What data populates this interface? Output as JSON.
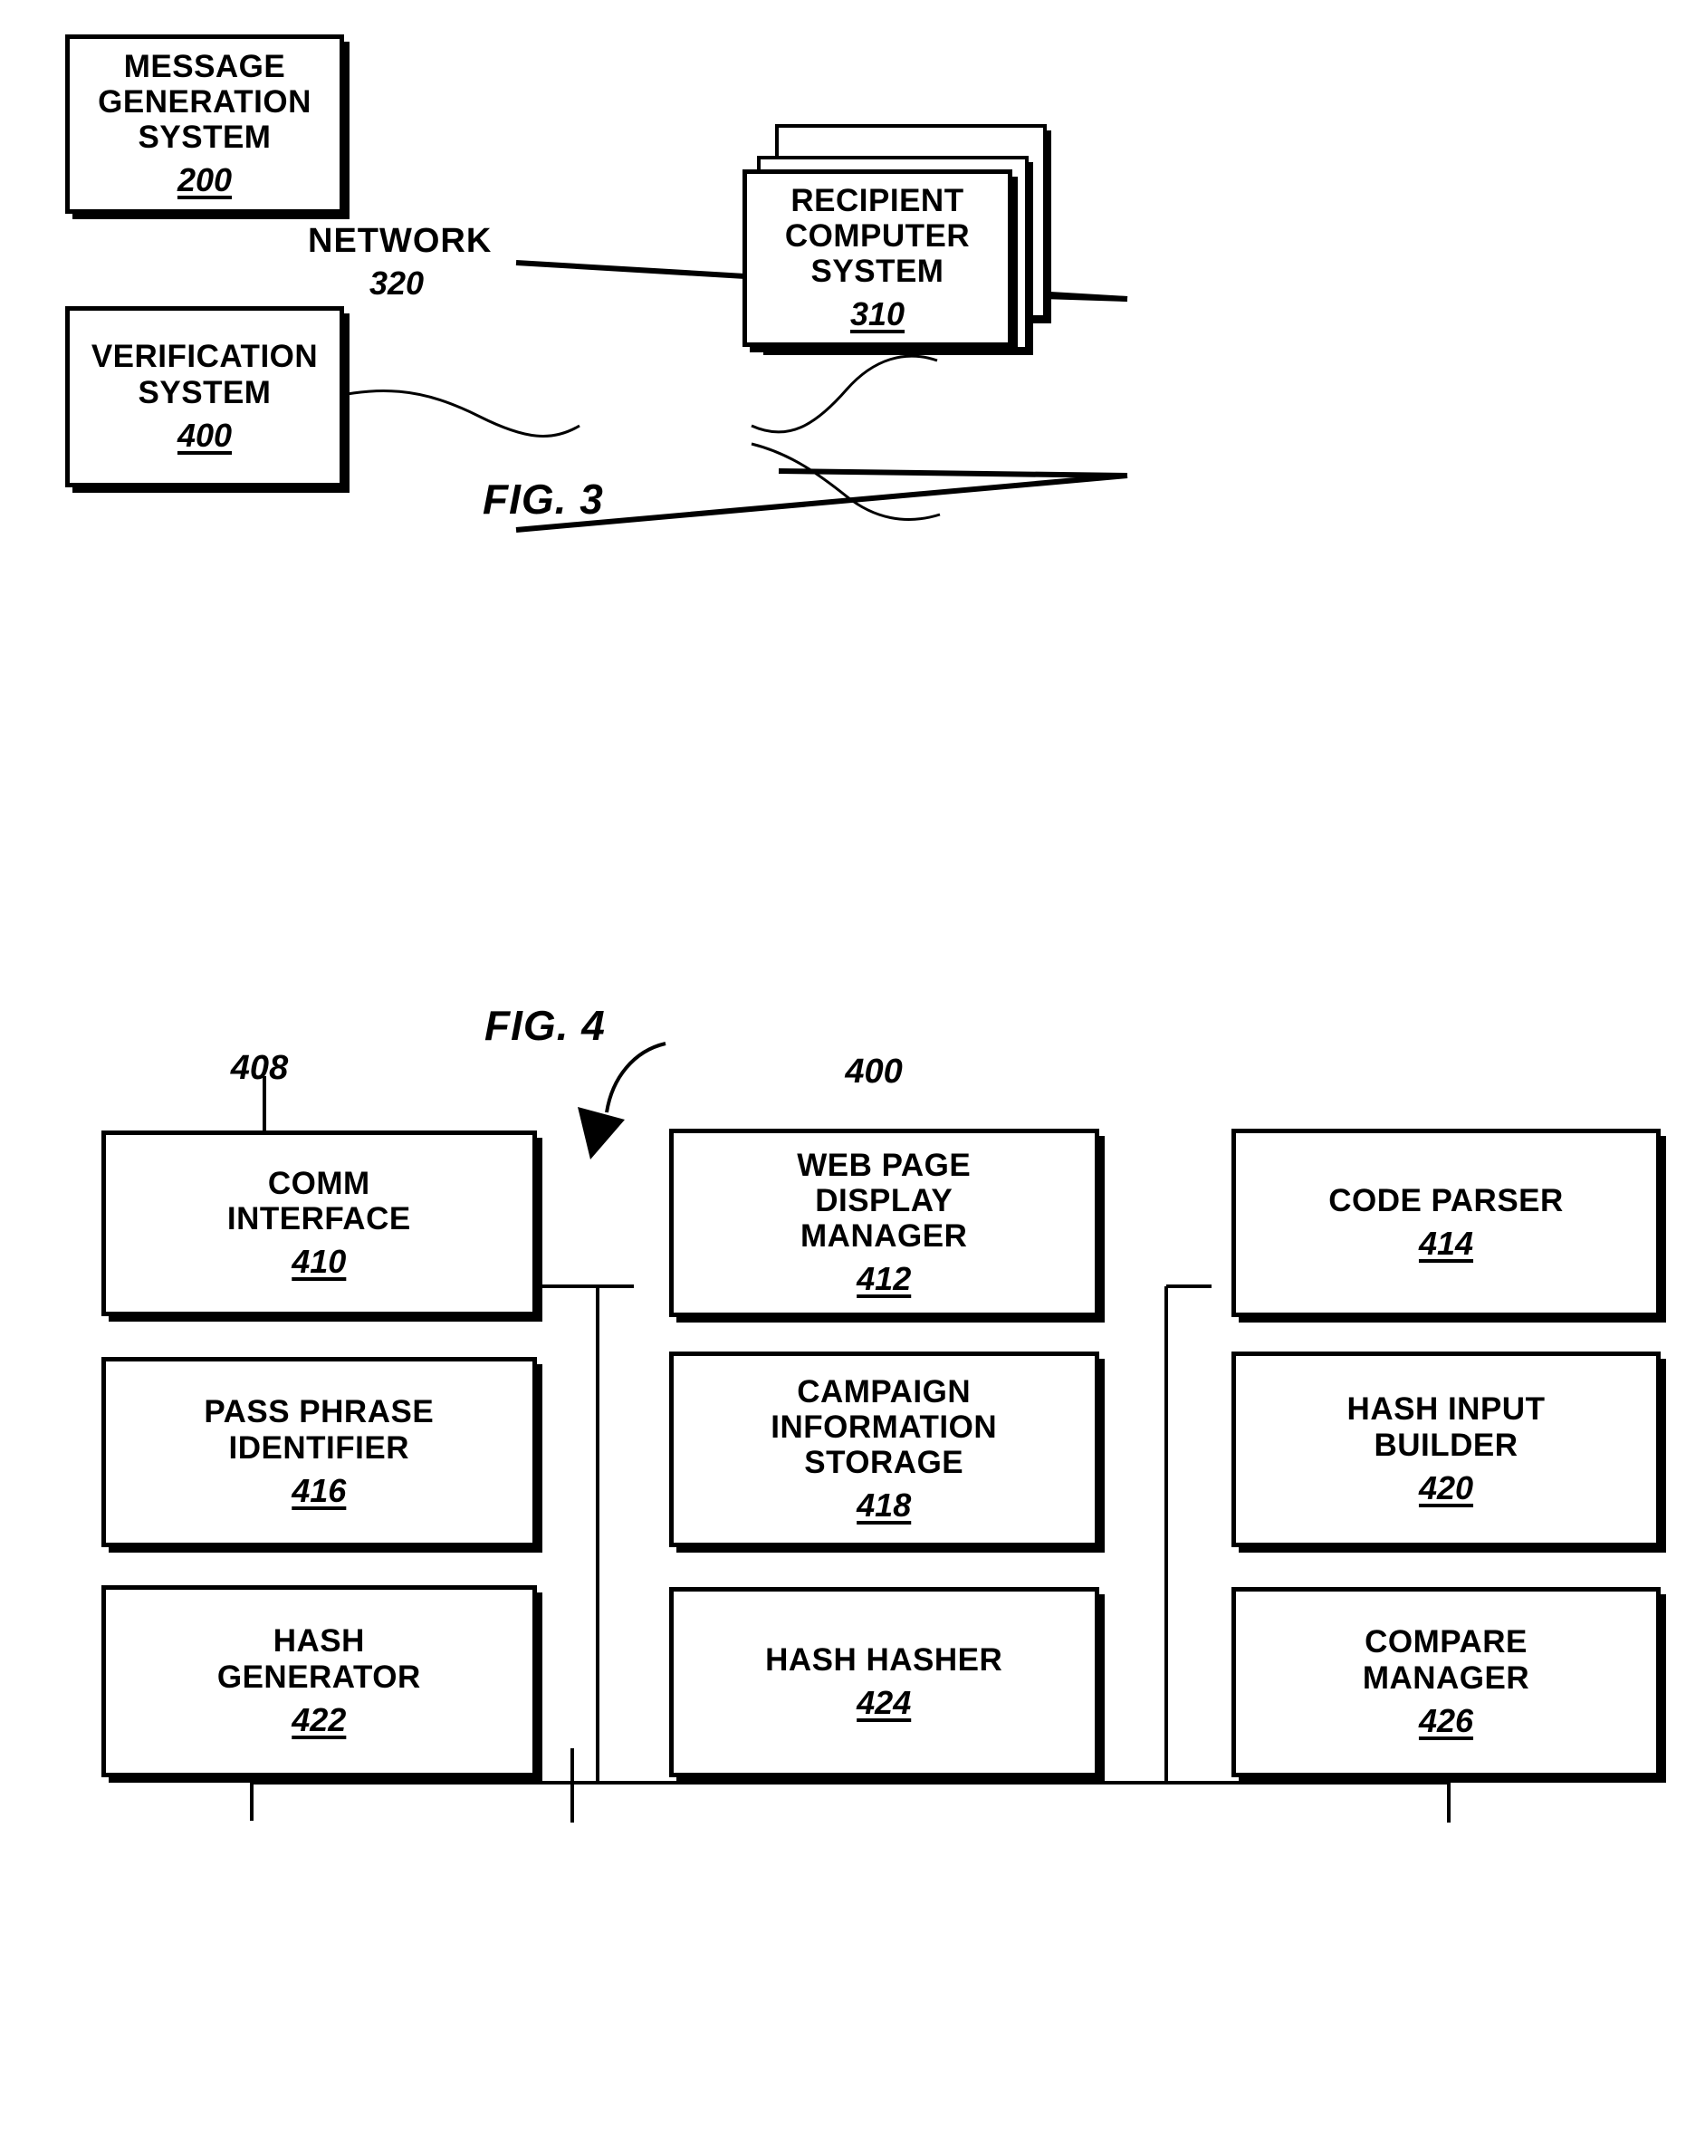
{
  "document": {
    "type": "patent-drawing-sheet"
  },
  "figures": [
    {
      "id": "fig3",
      "label": "FIG. 3",
      "nodes": [
        {
          "name": "message-generation-system",
          "title": "MESSAGE\nGENERATION\nSYSTEM",
          "ref": "200"
        },
        {
          "name": "verification-system",
          "title": "VERIFICATION\nSYSTEM",
          "ref": "400"
        },
        {
          "name": "recipient-computer-system",
          "title": "RECIPIENT\nCOMPUTER\nSYSTEM",
          "ref": "310"
        }
      ],
      "network": {
        "label": "NETWORK",
        "ref": "320"
      }
    },
    {
      "id": "fig4",
      "label": "FIG. 4",
      "system_ref": "400",
      "bus_ref": "408",
      "nodes": [
        {
          "name": "comm-interface",
          "title": "COMM\nINTERFACE",
          "ref": "410"
        },
        {
          "name": "web-page-display-manager",
          "title": "WEB PAGE\nDISPLAY\nMANAGER",
          "ref": "412"
        },
        {
          "name": "code-parser",
          "title": "CODE PARSER",
          "ref": "414"
        },
        {
          "name": "pass-phrase-identifier",
          "title": "PASS PHRASE\nIDENTIFIER",
          "ref": "416"
        },
        {
          "name": "campaign-information-storage",
          "title": "CAMPAIGN\nINFORMATION\nSTORAGE",
          "ref": "418"
        },
        {
          "name": "hash-input-builder",
          "title": "HASH INPUT\nBUILDER",
          "ref": "420"
        },
        {
          "name": "hash-generator",
          "title": "HASH\nGENERATOR",
          "ref": "422"
        },
        {
          "name": "hash-hasher",
          "title": "HASH HASHER",
          "ref": "424"
        },
        {
          "name": "compare-manager",
          "title": "COMPARE\nMANAGER",
          "ref": "426"
        }
      ]
    }
  ],
  "colors": {
    "ink": "#000000",
    "paper": "#ffffff"
  }
}
